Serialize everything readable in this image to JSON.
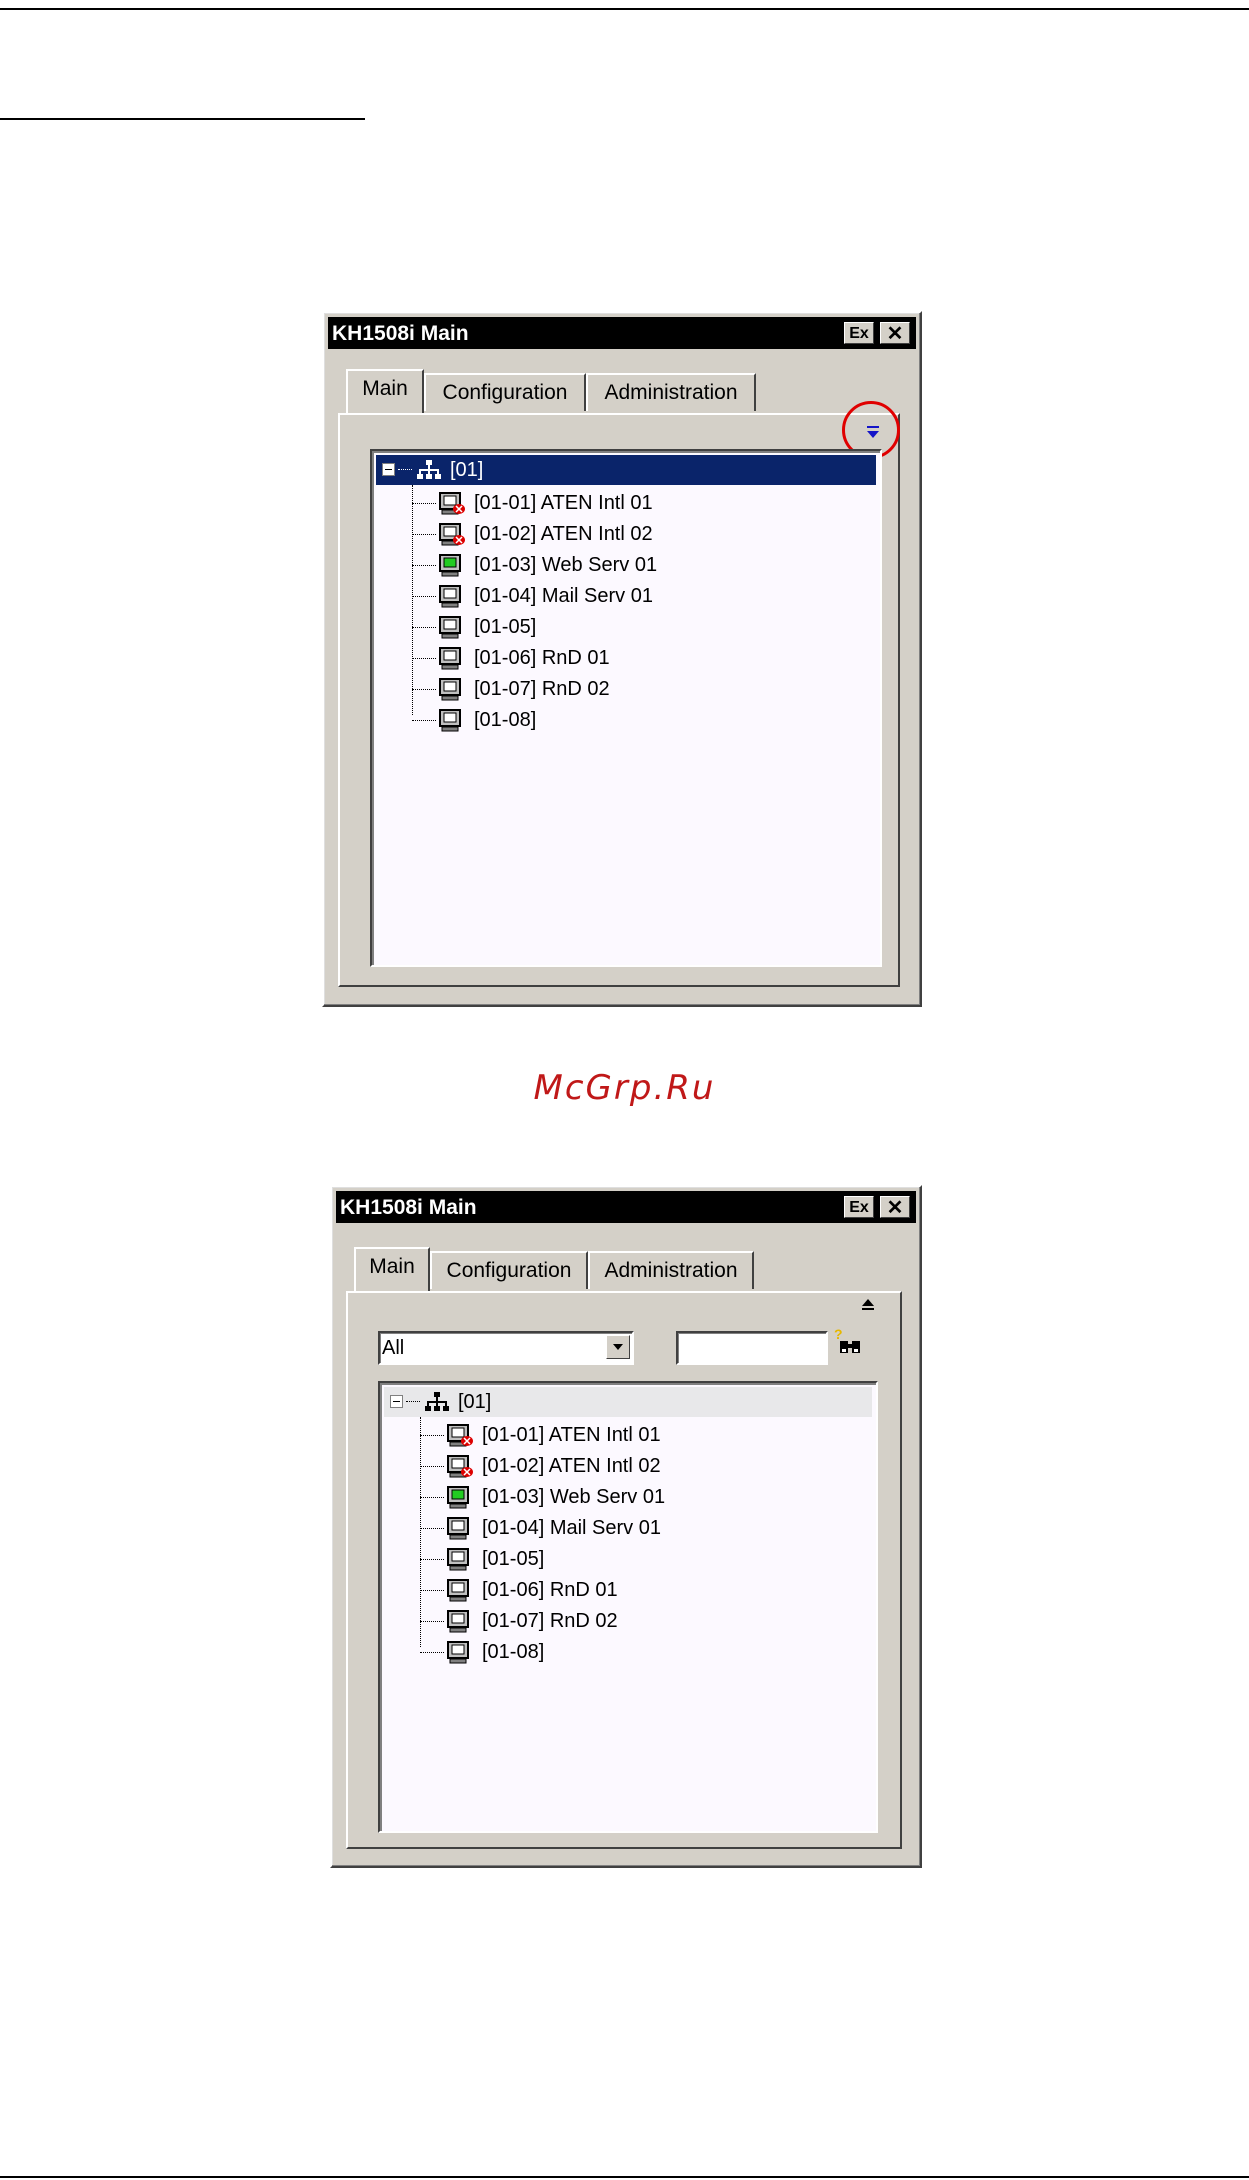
{
  "watermark": "McGrp.Ru",
  "window_top": {
    "title": "KH1508i Main",
    "ex_label": "Ex",
    "close_label": "✕",
    "tabs": [
      "Main",
      "Configuration",
      "Administration"
    ],
    "collapse_icon": "▼",
    "highlight_color": "#e00000",
    "tree": {
      "root": "[01]",
      "nodes": [
        {
          "label": "[01-01] ATEN Intl 01",
          "status": "offline"
        },
        {
          "label": "[01-02] ATEN Intl 02",
          "status": "offline"
        },
        {
          "label": "[01-03] Web Serv 01",
          "status": "online"
        },
        {
          "label": "[01-04] Mail Serv 01",
          "status": "normal"
        },
        {
          "label": "[01-05]",
          "status": "normal"
        },
        {
          "label": "[01-06] RnD 01",
          "status": "normal"
        },
        {
          "label": "[01-07] RnD 02",
          "status": "normal"
        },
        {
          "label": "[01-08]",
          "status": "normal"
        }
      ]
    }
  },
  "window_bottom": {
    "title": "KH1508i Main",
    "ex_label": "Ex",
    "close_label": "✕",
    "tabs": [
      "Main",
      "Configuration",
      "Administration"
    ],
    "expand_icon": "⏏",
    "filter_value": "All",
    "search_value": "",
    "tree": {
      "root": "[01]",
      "nodes": [
        {
          "label": "[01-01] ATEN Intl 01",
          "status": "offline"
        },
        {
          "label": "[01-02] ATEN Intl 02",
          "status": "offline"
        },
        {
          "label": "[01-03] Web Serv 01",
          "status": "online"
        },
        {
          "label": "[01-04] Mail Serv 01",
          "status": "normal"
        },
        {
          "label": "[01-05]",
          "status": "normal"
        },
        {
          "label": "[01-06] RnD 01",
          "status": "normal"
        },
        {
          "label": "[01-07] RnD 02",
          "status": "normal"
        },
        {
          "label": "[01-08]",
          "status": "normal"
        }
      ]
    }
  },
  "colors": {
    "selected_bg": "#0a246a",
    "watermark": "#c01818",
    "online": "#22cc22",
    "offline": "#dd0000"
  }
}
